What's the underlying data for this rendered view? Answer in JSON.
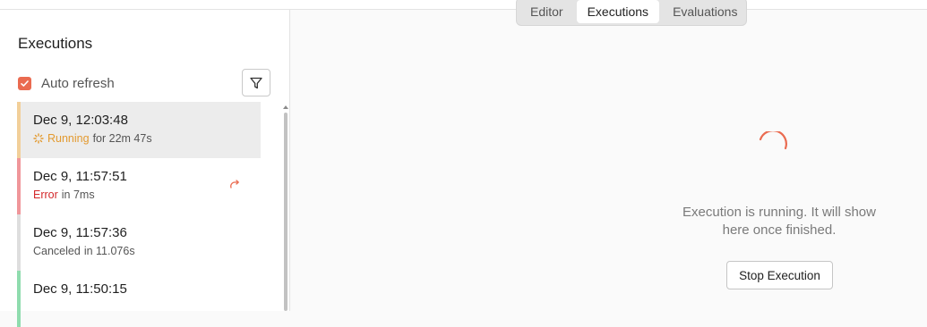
{
  "tabs": [
    {
      "label": "Editor",
      "active": false
    },
    {
      "label": "Executions",
      "active": true
    },
    {
      "label": "Evaluations",
      "active": false
    }
  ],
  "sidebar": {
    "title": "Executions",
    "auto_refresh": {
      "label": "Auto refresh",
      "checked": true
    },
    "filter_icon": "filter-icon"
  },
  "executions": [
    {
      "date": "Dec 9, 12:03:48",
      "status": "Running",
      "detail": "for 22m 47s",
      "color": "#f2cf99",
      "selected": true
    },
    {
      "date": "Dec 9, 11:57:51",
      "status": "Error",
      "detail": "in 7ms",
      "color": "#f0969a",
      "retry_icon": "retry-icon"
    },
    {
      "date": "Dec 9, 11:57:36",
      "status": "Canceled",
      "detail": "in 11.076s",
      "color": "#dedede"
    },
    {
      "date": "Dec 9, 11:50:15",
      "status": "",
      "detail": "",
      "color": "#8fdcae"
    }
  ],
  "main": {
    "message": "Execution is running. It will show here once finished.",
    "stop_button": "Stop Execution"
  },
  "colors": {
    "accent": "#ea6b50",
    "running": "#e39a30",
    "error": "#d3272a"
  }
}
